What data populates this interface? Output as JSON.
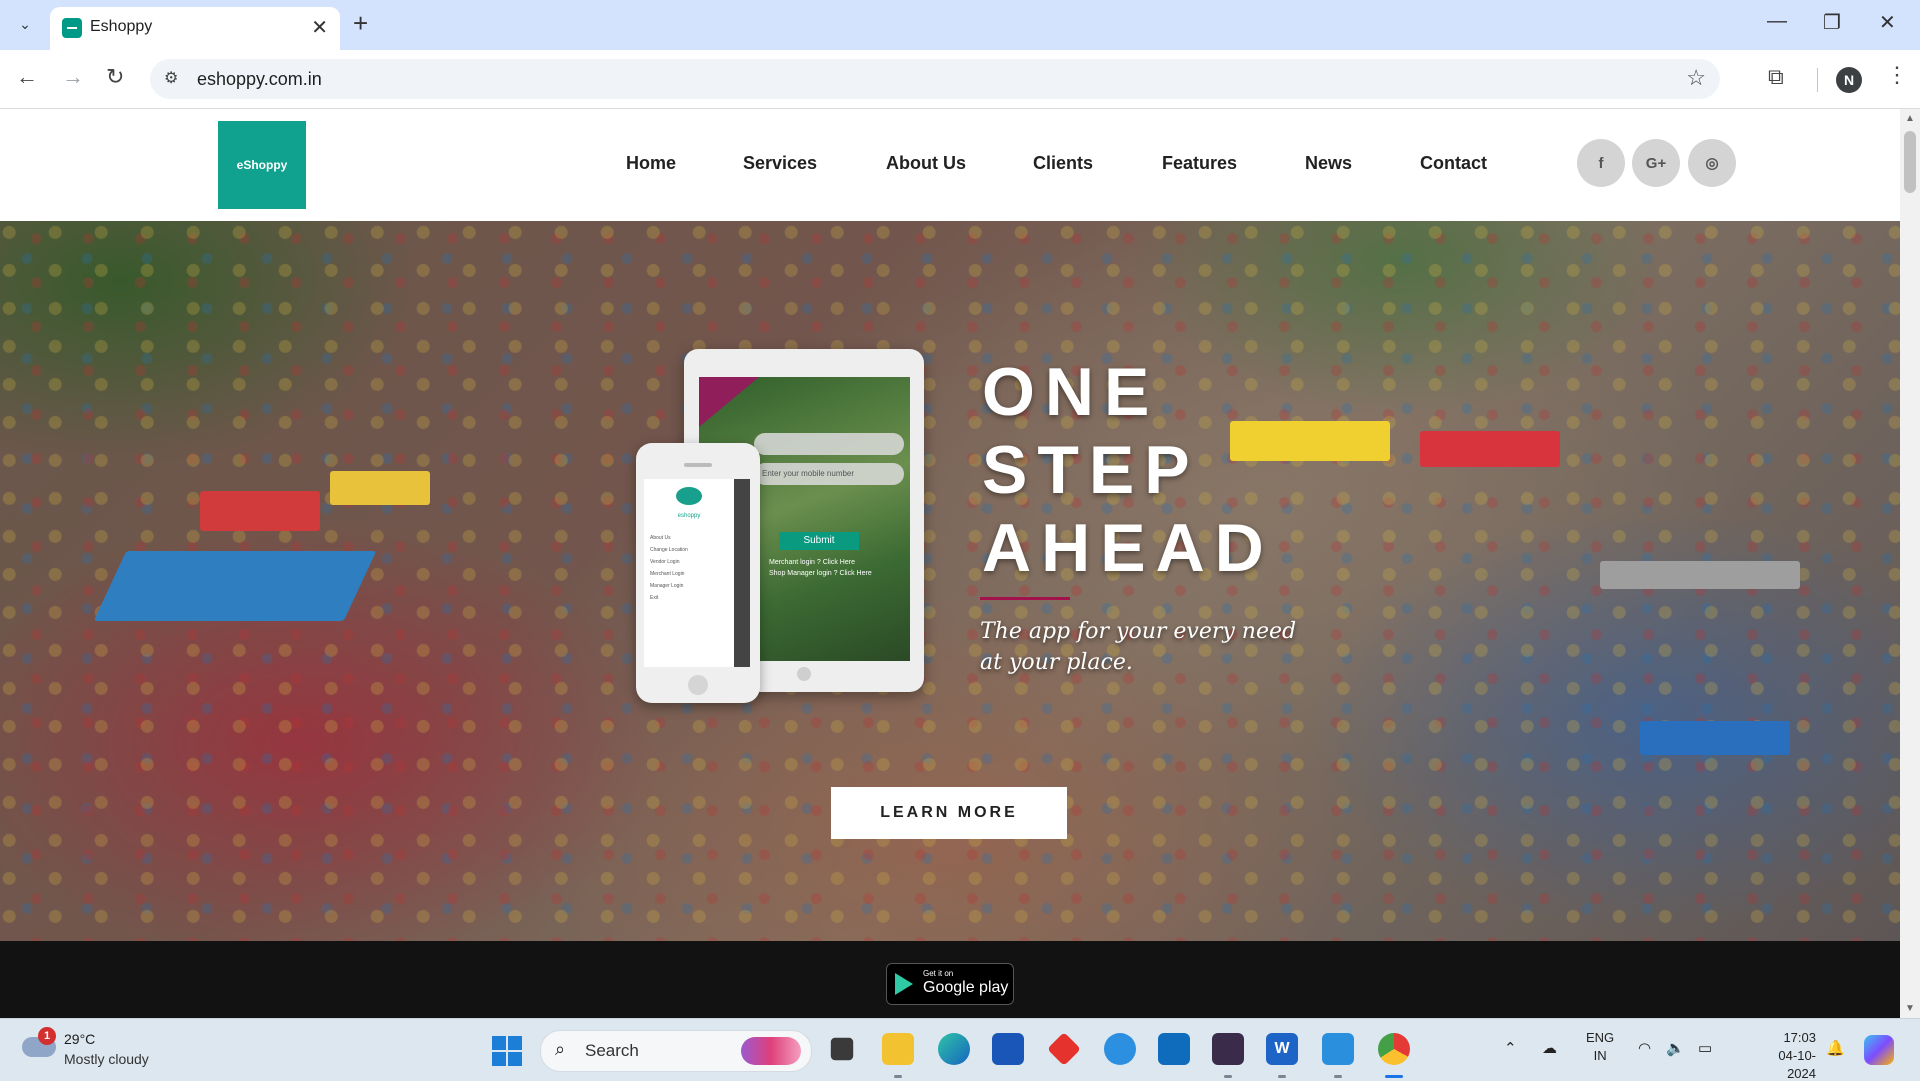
{
  "browser": {
    "tab_title": "Eshoppy",
    "tab_close": "✕",
    "new_tab": "+",
    "url": "eshoppy.com.in",
    "profile_initial": "N",
    "window_controls": {
      "minimize": "—",
      "restore": "❐",
      "close": "✕"
    }
  },
  "site": {
    "logo_text": "eShoppy",
    "nav": [
      "Home",
      "Services",
      "About Us",
      "Clients",
      "Features",
      "News",
      "Contact"
    ],
    "social": {
      "facebook": "f",
      "google_plus": "G+",
      "instagram": "◎"
    }
  },
  "hero": {
    "title_lines": [
      "ONE",
      "STEP",
      "AHEAD"
    ],
    "tagline": "The app for your every need at your place.",
    "cta": "LEARN MORE",
    "tablet": {
      "field1": "Enter your mobile number",
      "submit": "Submit",
      "link1": "Merchant login ? Click Here",
      "link2": "Shop Manager login ? Click Here"
    },
    "phone": {
      "app_name": "eshoppy",
      "menu": [
        "About Us",
        "Change Location",
        "Vendor Login",
        "Merchant Login",
        "Manager Login",
        "Exit"
      ]
    }
  },
  "store_badge": {
    "small": "Get it on",
    "big": "Google play"
  },
  "taskbar": {
    "weather": {
      "temp": "29°C",
      "condition": "Mostly cloudy",
      "badge": "1"
    },
    "search_placeholder": "Search",
    "lang_line1": "ENG",
    "lang_line2": "IN",
    "time": "17:03",
    "date": "04-10-2024",
    "colors": {
      "accent": "#1a73e8",
      "brand": "#11a28f",
      "hero_accent": "#a4124d"
    }
  }
}
